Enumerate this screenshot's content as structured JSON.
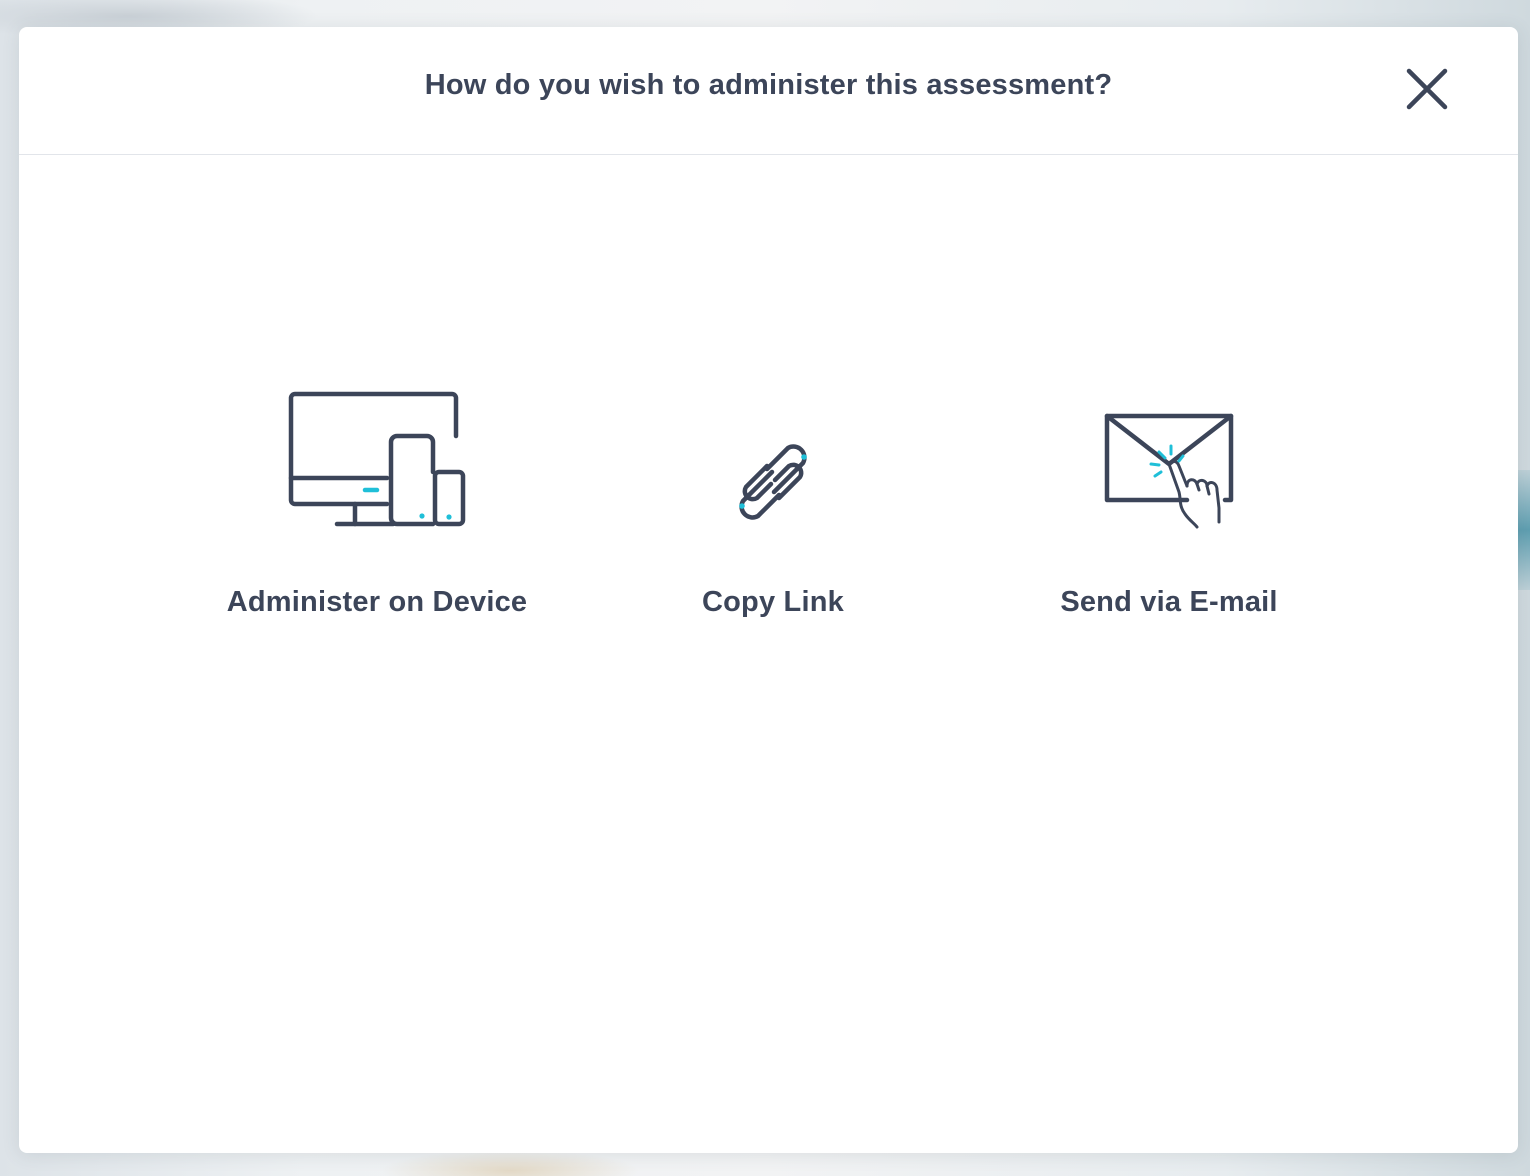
{
  "dialog": {
    "title": "How do you wish to administer this assessment?",
    "close_icon": "close-icon"
  },
  "options": [
    {
      "label": "Administer on Device",
      "icon": "devices-icon"
    },
    {
      "label": "Copy Link",
      "icon": "link-icon"
    },
    {
      "label": "Send via E-mail",
      "icon": "envelope-tap-icon"
    }
  ],
  "colors": {
    "text": "#3c4559",
    "icon_stroke": "#3c4559",
    "accent": "#1fbfd8",
    "divider": "#e2e5ea",
    "modal_bg": "#ffffff"
  }
}
